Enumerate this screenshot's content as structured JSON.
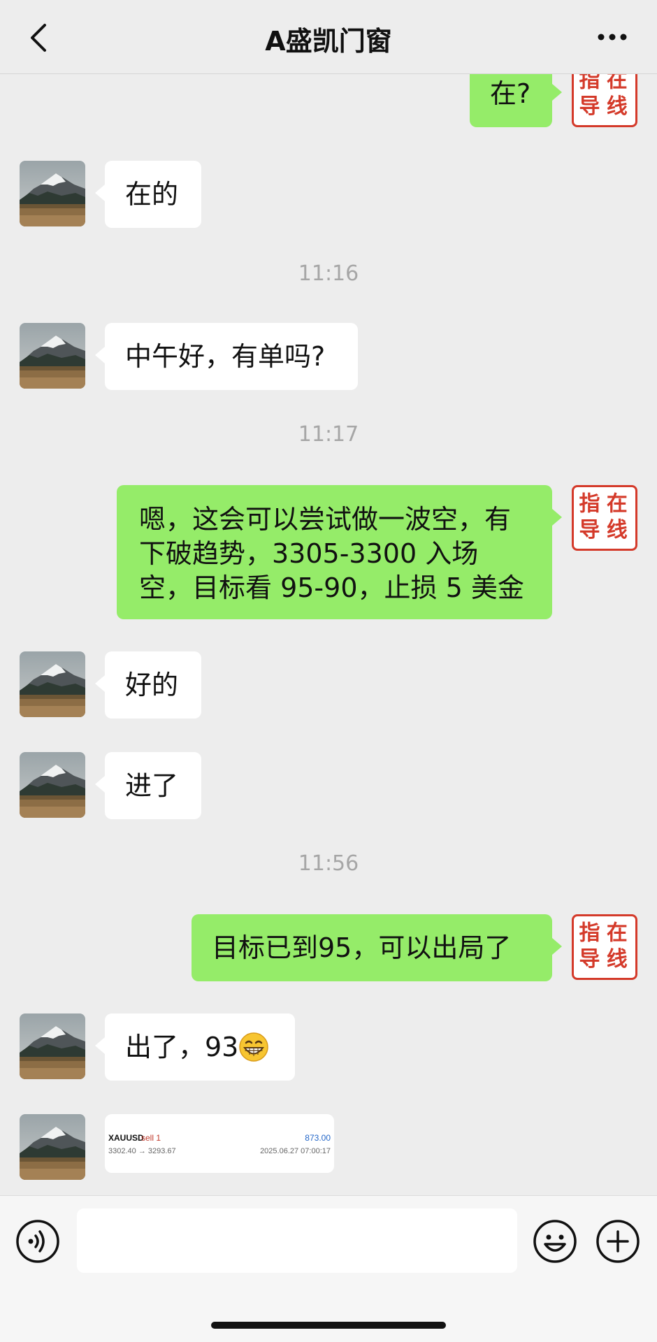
{
  "header": {
    "title": "A盛凯门窗"
  },
  "stamp_text": "指在导线",
  "messages": {
    "m1": "在?",
    "m2": "在的",
    "t1": "11:16",
    "m3": "中午好，有单吗?",
    "t2": "11:17",
    "m4_line1": "嗯，这会可以尝试做一波空，有",
    "m4_line2": "下破趋势，3305-3300 入场",
    "m4_line3": "空，目标看 95-90，止损 5 美金",
    "m5": "好的",
    "m6": "进了",
    "t3": "11:56",
    "m7": "目标已到95，可以出局了",
    "m8": "出了，93",
    "m8_emoji": "grinning-face-emoji"
  },
  "trade_card": {
    "symbol": "XAUUSD",
    "side": "sell 1",
    "profit": "873.00",
    "prices": "3302.40 → 3293.67",
    "time": "2025.06.27 07:00:17"
  },
  "input": {
    "placeholder": ""
  },
  "colors": {
    "background": "#ededed",
    "incoming_bubble": "#ffffff",
    "outgoing_bubble": "#95ec69",
    "stamp_red": "#d43a2a",
    "time_label": "#a6a6a6",
    "profit_blue": "#2366c8"
  },
  "icons": [
    "back-arrow-icon",
    "more-icon",
    "voice-icon",
    "emoji-icon",
    "plus-icon"
  ]
}
